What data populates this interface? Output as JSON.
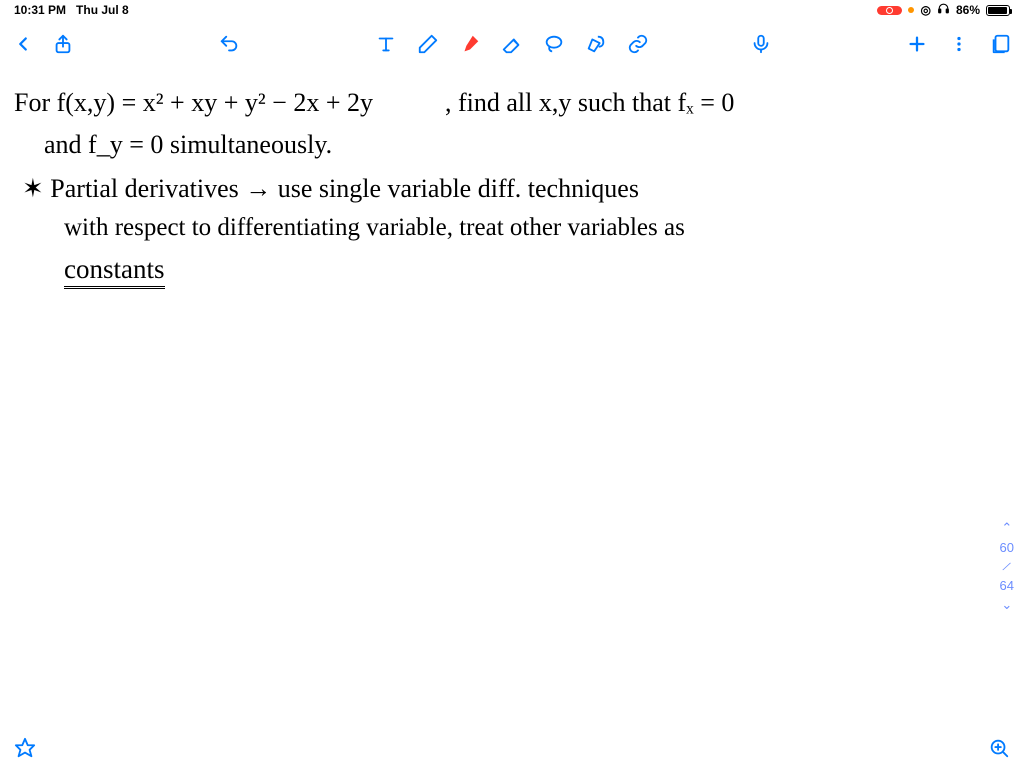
{
  "status": {
    "time": "10:31 PM",
    "date": "Thu Jul 8",
    "battery_pct": "86%",
    "target_icon": "◎",
    "headphone_icon": "♫"
  },
  "toolbar": {
    "back": "Back",
    "share": "Share",
    "undo": "Undo",
    "text_tool": "Text",
    "pencil": "Pencil",
    "highlighter": "Highlighter",
    "eraser": "Eraser",
    "lasso": "Lasso",
    "shapes": "Shapes",
    "link": "Link",
    "mic": "Microphone",
    "add": "Add",
    "more": "More",
    "pages": "Page View"
  },
  "notes": {
    "line1a": "For f(x,y) = x² + xy + y² − 2x + 2y",
    "line1b": ", find all x,y such that  fₓ = 0",
    "line2": "and  f_y = 0  simultaneously.",
    "line3": "✶  Partial derivatives → use single variable diff. techniques",
    "line4": "with respect to differentiating variable, treat other variables as",
    "line5": "constants"
  },
  "pagenav": {
    "up": "⌃",
    "current": "60",
    "sep": "∕",
    "total": "64",
    "down": "⌄"
  },
  "bottom": {
    "fav": "Favorite",
    "zoom": "Zoom In"
  }
}
